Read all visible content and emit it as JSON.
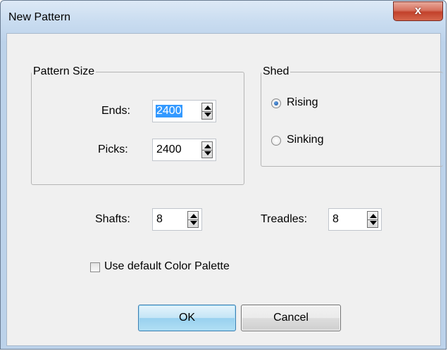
{
  "window": {
    "title": "New Pattern",
    "close_label": "x"
  },
  "pattern_size": {
    "legend": "Pattern Size",
    "ends_label": "Ends:",
    "ends_value": "2400",
    "picks_label": "Picks:",
    "picks_value": "2400"
  },
  "shed": {
    "legend": "Shed",
    "options": [
      {
        "label": "Rising",
        "selected": true
      },
      {
        "label": "Sinking",
        "selected": false
      }
    ]
  },
  "shafts": {
    "label": "Shafts:",
    "value": "8"
  },
  "treadles": {
    "label": "Treadles:",
    "value": "8"
  },
  "palette": {
    "label": "Use default Color Palette",
    "checked": false
  },
  "buttons": {
    "ok": "OK",
    "cancel": "Cancel"
  }
}
